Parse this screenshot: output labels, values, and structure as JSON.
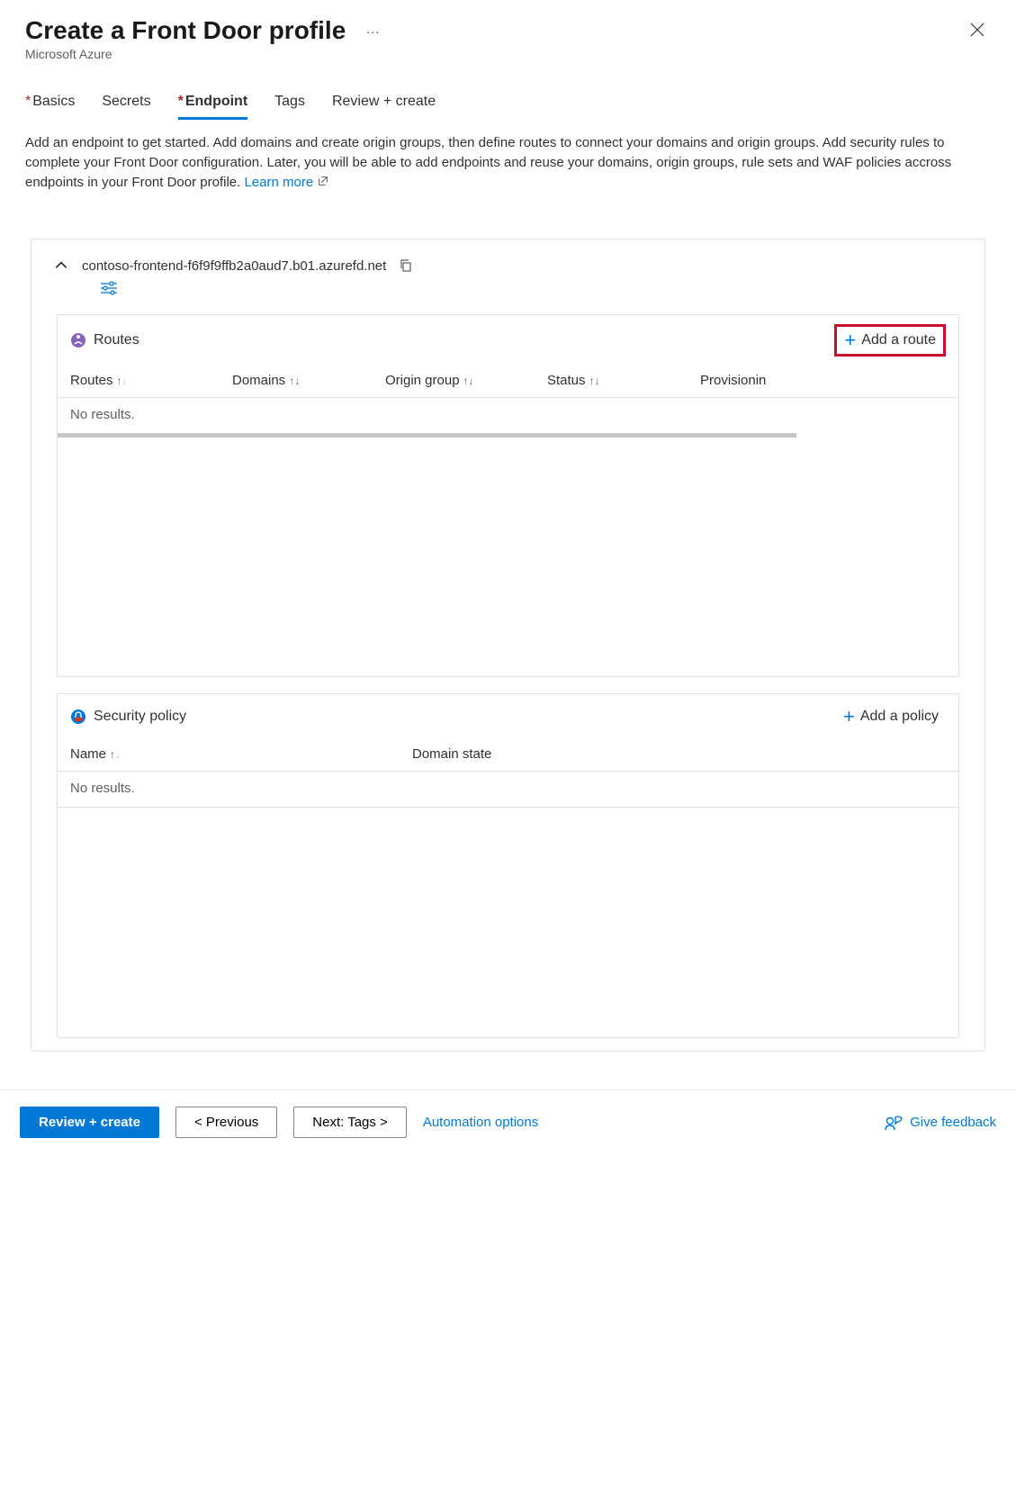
{
  "header": {
    "title": "Create a Front Door profile",
    "subtitle": "Microsoft Azure"
  },
  "tabs": [
    {
      "label": "Basics",
      "required": true,
      "active": false
    },
    {
      "label": "Secrets",
      "required": false,
      "active": false
    },
    {
      "label": "Endpoint",
      "required": true,
      "active": true
    },
    {
      "label": "Tags",
      "required": false,
      "active": false
    },
    {
      "label": "Review + create",
      "required": false,
      "active": false
    }
  ],
  "description": "Add an endpoint to get started. Add domains and create origin groups, then define routes to connect your domains and origin groups. Add security rules to complete your Front Door configuration. Later, you will be able to add endpoints and reuse your domains, origin groups, rule sets and WAF policies accross endpoints in your Front Door profile.",
  "learn_more_label": "Learn more",
  "endpoint": {
    "domain": "contoso-frontend-f6f9f9ffb2a0aud7.b01.azurefd.net"
  },
  "routes_panel": {
    "title": "Routes",
    "add_label": "Add a route",
    "columns": {
      "routes": "Routes",
      "domains": "Domains",
      "origin_group": "Origin group",
      "status": "Status",
      "provisioning": "Provisionin"
    },
    "empty": "No results."
  },
  "security_panel": {
    "title": "Security policy",
    "add_label": "Add a policy",
    "columns": {
      "name": "Name",
      "domain_state": "Domain state"
    },
    "empty": "No results."
  },
  "footer": {
    "review": "Review + create",
    "previous": "<  Previous",
    "next": "Next: Tags  >",
    "automation": "Automation options",
    "feedback": "Give feedback"
  }
}
